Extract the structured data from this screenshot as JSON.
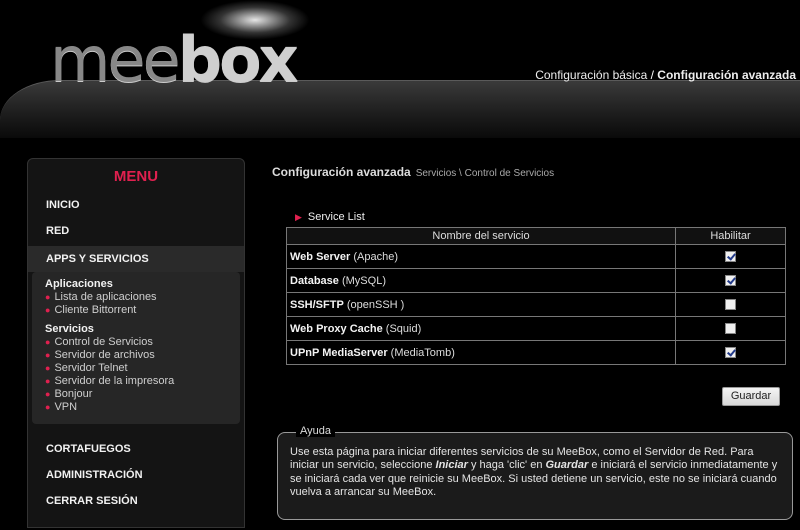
{
  "header": {
    "logo_mee": "mee",
    "logo_box": "box",
    "links": [
      {
        "label": "Configuración básica"
      },
      {
        "label": "Configuración avanzada"
      }
    ],
    "separator": " / "
  },
  "sidebar": {
    "menu_title": "MENU",
    "top_items": [
      {
        "label": "INICIO"
      },
      {
        "label": "RED"
      },
      {
        "label": "APPS Y SERVICIOS"
      }
    ],
    "submenu": {
      "group1": {
        "title": "Aplicaciones",
        "links": [
          "Lista de aplicaciones",
          "Cliente Bittorrent"
        ]
      },
      "group2": {
        "title": "Servicios",
        "links": [
          "Control de Servicios",
          "Servidor de archivos",
          "Servidor Telnet",
          "Servidor de la impresora",
          "Bonjour",
          "VPN"
        ]
      }
    },
    "bottom_items": [
      {
        "label": "CORTAFUEGOS"
      },
      {
        "label": "ADMINISTRACIÓN"
      },
      {
        "label": "CERRAR SESIÓN"
      }
    ]
  },
  "main": {
    "title": "Configuración avanzada",
    "breadcrumb": "Servicios \\ Control de Servicios",
    "section_label": "Service List",
    "table": {
      "headers": [
        "Nombre del servicio",
        "Habilitar"
      ],
      "rows": [
        {
          "name": "Web Server",
          "detail": " (Apache)",
          "enabled": true
        },
        {
          "name": "Database",
          "detail": " (MySQL)",
          "enabled": true
        },
        {
          "name": "SSH/SFTP",
          "detail": " (openSSH )",
          "enabled": false
        },
        {
          "name": "Web Proxy Cache",
          "detail": " (Squid)",
          "enabled": false
        },
        {
          "name": "UPnP MediaServer",
          "detail": " (MediaTomb)",
          "enabled": true
        }
      ]
    },
    "save_label": "Guardar",
    "help": {
      "legend": "Ayuda",
      "text_1": "Use esta página para iniciar diferentes servicios de su MeeBox, como el Servidor de Red. Para iniciar un servicio, seleccione ",
      "em_1": "Iniciar",
      "text_2": " y haga 'clic' en ",
      "em_2": "Guardar",
      "text_3": " e iniciará el servicio inmediatamente y se iniciará cada ver que reinicie su MeeBox. Si usted detiene un servicio, este no se iniciará cuando vuelva a arrancar su MeeBox."
    }
  },
  "colors": {
    "accent": "#e0204f",
    "background": "#000000",
    "panel": "#141414"
  }
}
